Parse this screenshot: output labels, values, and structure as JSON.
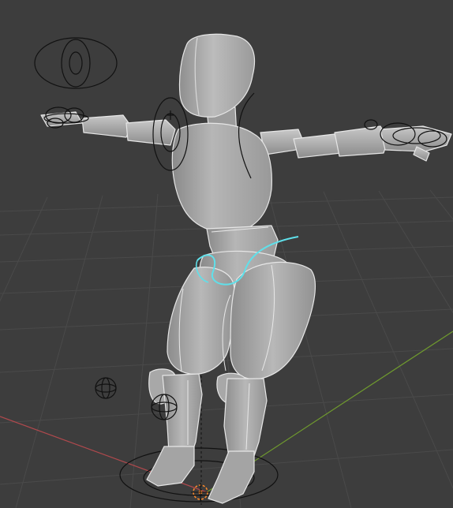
{
  "viewport": {
    "background": "#3d3d3d",
    "grid_color": "#4a4a4a",
    "x_axis_color": "#b0494d",
    "y_axis_color": "#6f9a2e",
    "mesh_color": "#a9a9a9",
    "mesh_edge_color": "#e8e8e8",
    "selected_color": "#5fe0ea",
    "control_color": "#111111",
    "origin_marker_color": "#ff8a2a"
  },
  "scene": {
    "object": "humanoid-mannequin",
    "shading": "solid",
    "pose": "t-pose",
    "selected_control": "hip-control-curve"
  }
}
